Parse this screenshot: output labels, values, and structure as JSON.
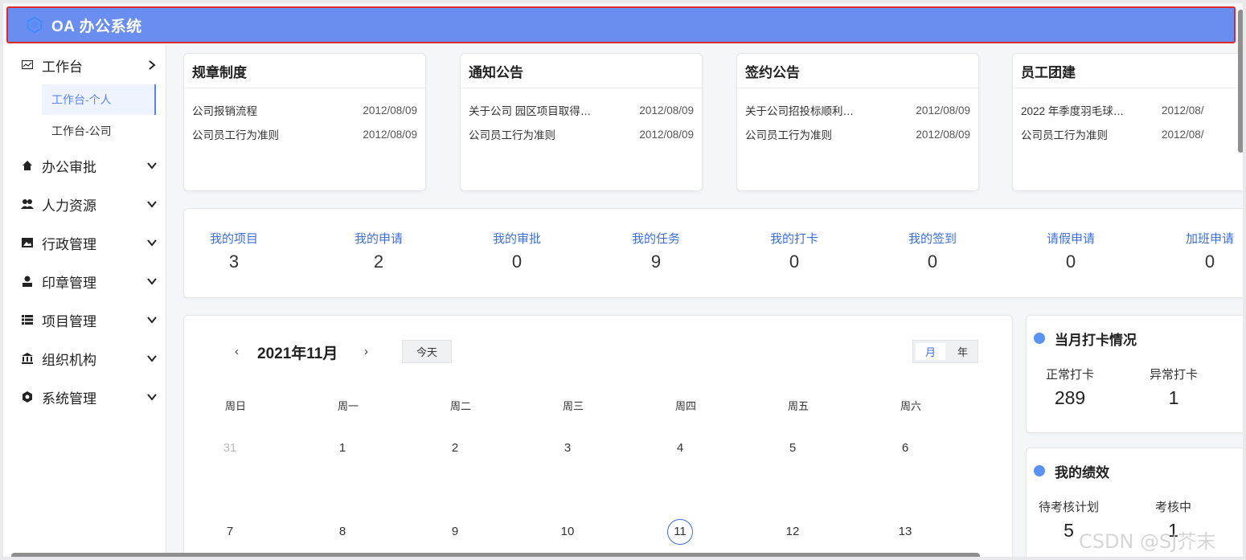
{
  "app": {
    "title": "OA 办公系统",
    "accent": "#6a8ef0"
  },
  "sidebar": {
    "items": [
      {
        "label": "工作台",
        "icon": "dashboard-icon",
        "arrow": "chevron-right-icon"
      },
      {
        "label": "办公审批",
        "icon": "home-icon",
        "arrow": "chevron-down-icon"
      },
      {
        "label": "人力资源",
        "icon": "users-icon",
        "arrow": "chevron-down-icon"
      },
      {
        "label": "行政管理",
        "icon": "image-icon",
        "arrow": "chevron-down-icon"
      },
      {
        "label": "印章管理",
        "icon": "user-icon",
        "arrow": "chevron-down-icon"
      },
      {
        "label": "项目管理",
        "icon": "list-icon",
        "arrow": "chevron-down-icon"
      },
      {
        "label": "组织机构",
        "icon": "bank-icon",
        "arrow": "chevron-down-icon"
      },
      {
        "label": "系统管理",
        "icon": "hexagon-icon",
        "arrow": "chevron-down-icon"
      }
    ],
    "subitems": [
      {
        "label": "工作台-个人",
        "active": true
      },
      {
        "label": "工作台-公司",
        "active": false
      }
    ]
  },
  "notices": [
    {
      "title": "规章制度",
      "rows": [
        {
          "text": "公司报销流程",
          "date": "2012/08/09"
        },
        {
          "text": "公司员工行为准则",
          "date": "2012/08/09"
        }
      ]
    },
    {
      "title": "通知公告",
      "rows": [
        {
          "text": "关于公司 园区项目取得…",
          "date": "2012/08/09"
        },
        {
          "text": "公司员工行为准则",
          "date": "2012/08/09"
        }
      ]
    },
    {
      "title": "签约公告",
      "rows": [
        {
          "text": "关于公司招投标顺利…",
          "date": "2012/08/09"
        },
        {
          "text": "公司员工行为准则",
          "date": "2012/08/09"
        }
      ]
    },
    {
      "title": "员工团建",
      "rows": [
        {
          "text": "2022 年季度羽毛球…",
          "date": "2012/08/"
        },
        {
          "text": "公司员工行为准则",
          "date": "2012/08/"
        }
      ]
    }
  ],
  "stats": [
    {
      "label": "我的项目",
      "value": "3"
    },
    {
      "label": "我的申请",
      "value": "2"
    },
    {
      "label": "我的审批",
      "value": "0"
    },
    {
      "label": "我的任务",
      "value": "9"
    },
    {
      "label": "我的打卡",
      "value": "0"
    },
    {
      "label": "我的签到",
      "value": "0"
    },
    {
      "label": "请假申请",
      "value": "0"
    },
    {
      "label": "加班申请",
      "value": "0"
    }
  ],
  "calendar": {
    "prev": "‹",
    "next": "›",
    "title": "2021年11月",
    "today_label": "今天",
    "modes": [
      "月",
      "年"
    ],
    "active_mode": "月",
    "weekdays": [
      "周日",
      "周一",
      "周二",
      "周三",
      "周四",
      "周五",
      "周六"
    ],
    "week1": [
      "31",
      "1",
      "2",
      "3",
      "4",
      "5",
      "6"
    ],
    "week2": [
      "7",
      "8",
      "9",
      "10",
      "11",
      "12",
      "13"
    ],
    "today": "11"
  },
  "attendance": {
    "title": "当月打卡情况",
    "normal_label": "正常打卡",
    "normal_value": "289",
    "abnormal_label": "异常打卡",
    "abnormal_value": "1"
  },
  "performance": {
    "title": "我的绩效",
    "pending_label": "待考核计划",
    "pending_value": "5",
    "review_label": "考核中",
    "review_value": "1"
  },
  "watermark": "CSDN @SJ芥末"
}
